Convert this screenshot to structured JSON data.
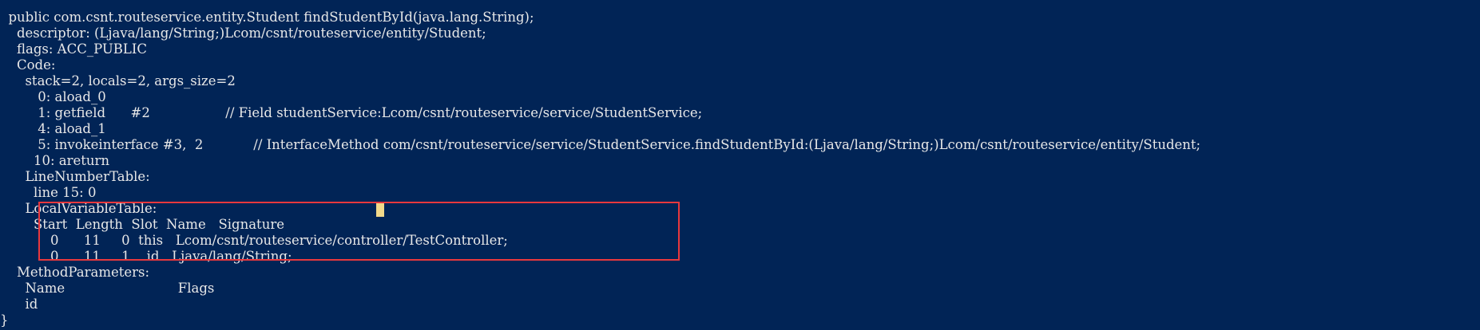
{
  "terminal": {
    "lines": [
      "  public com.csnt.routeservice.entity.Student findStudentById(java.lang.String);",
      "    descriptor: (Ljava/lang/String;)Lcom/csnt/routeservice/entity/Student;",
      "    flags: ACC_PUBLIC",
      "    Code:",
      "      stack=2, locals=2, args_size=2",
      "         0: aload_0",
      "         1: getfield      #2                  // Field studentService:Lcom/csnt/routeservice/service/StudentService;",
      "         4: aload_1",
      "         5: invokeinterface #3,  2            // InterfaceMethod com/csnt/routeservice/service/StudentService.findStudentById:(Ljava/lang/String;)Lcom/csnt/routeservice/entity/Student;",
      "        10: areturn",
      "      LineNumberTable:",
      "        line 15: 0",
      "      LocalVariableTable:",
      "        Start  Length  Slot  Name   Signature",
      "            0      11     0  this   Lcom/csnt/routeservice/controller/TestController;",
      "            0      11     1    id   Ljava/lang/String;",
      "    MethodParameters:",
      "      Name                           Flags",
      "      id",
      "}"
    ]
  },
  "colors": {
    "background": "#012456",
    "text": "#e8e8e8",
    "highlight_border": "#e8383d",
    "cursor": "#f2d98a"
  }
}
